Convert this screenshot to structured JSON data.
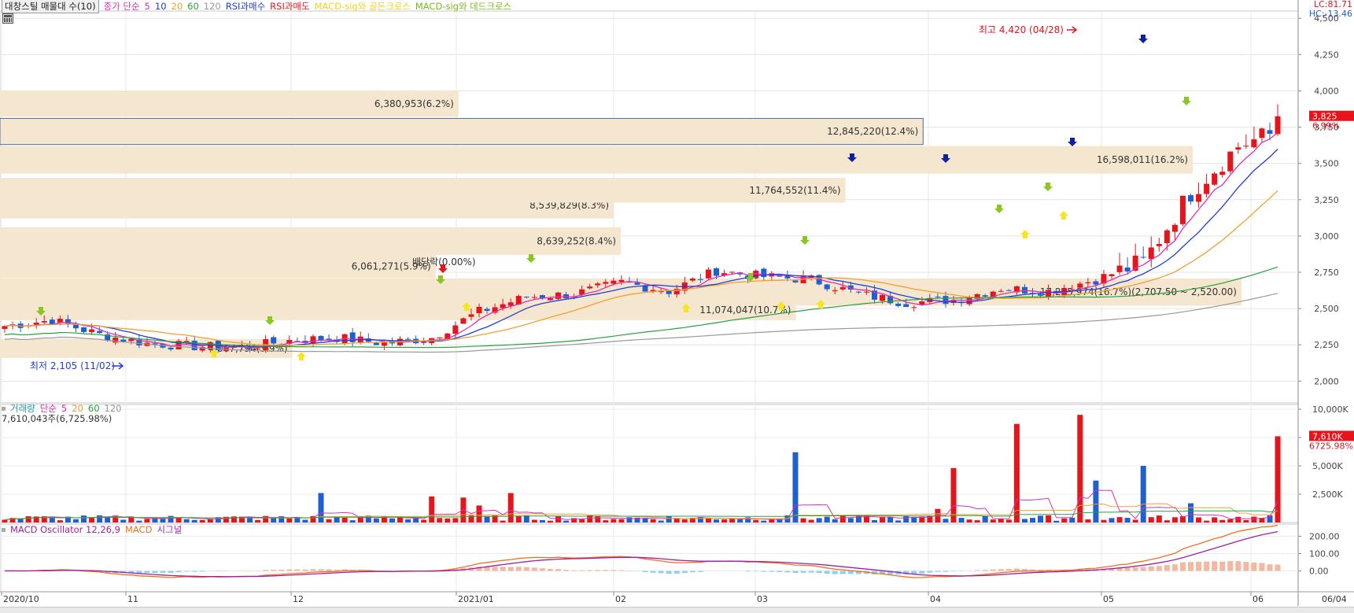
{
  "legend": {
    "main_title": "대창스틸 매물대 수(10)",
    "ma_label": "종가 단순",
    "ma_periods": [
      "5",
      "10",
      "20",
      "60",
      "120"
    ],
    "ma_colors": [
      "#d633b5",
      "#1f3fd6",
      "#f0a030",
      "#2aa040",
      "#999999"
    ],
    "rsi_buy": "RSI과매수",
    "rsi_sell": "RSI과매도",
    "macd_golden": "MACD-sig와 골든크로스",
    "macd_dead": "MACD-sig와 데드크로스"
  },
  "corner": {
    "lc": "LC:81.71",
    "hc": "HC:-13.46"
  },
  "price_label": {
    "value": "3,825",
    "pct": "6.99%"
  },
  "volume_label": {
    "value": "7,610K",
    "pct": "6725.98%"
  },
  "volume_legend": {
    "title": "거래량",
    "ma_label": "단순",
    "periods": [
      "5",
      "20",
      "60",
      "120"
    ],
    "readout": "7,610,043주(6,725.98%)"
  },
  "macd_legend": {
    "osc": "MACD Oscillator 12,26,9",
    "macd": "MACD",
    "signal": "시그널"
  },
  "annotations": {
    "high": "최고 4,420 (04/28)",
    "low": "최저 2,105 (11/02)",
    "dividend": "배당락(0.00%)"
  },
  "colors": {
    "up": "#e8141b",
    "down": "#1f5fd0",
    "zone": "#f5e6d0",
    "zone_border": "#4a6fa5",
    "macd": "#f07020",
    "signal": "#a020a0",
    "osc_pos": "#f4b8a0",
    "osc_neg": "#8fd0f0",
    "arrow_yellow": "#f5e620",
    "arrow_green": "#8ac820",
    "arrow_blue": "#1020a0"
  },
  "chart_data": [
    {
      "type": "candlestick",
      "panel": "price",
      "ylim": [
        1850,
        4550
      ],
      "y_ticks": [
        "2,000",
        "2,250",
        "2,500",
        "2,750",
        "3,000",
        "3,250",
        "3,500",
        "3,750",
        "4,000",
        "4,250",
        "4,500"
      ],
      "x_labels": [
        "2020/10",
        "11",
        "12",
        "2021/01",
        "02",
        "03",
        "04",
        "05",
        "06",
        "06/04"
      ],
      "volume_profile": [
        {
          "label": "4,067,794(3.9%)",
          "lo": 2160,
          "hi": 2290,
          "volume": 4067794
        },
        {
          "label": "11,074,047(10.7%)",
          "lo": 2420,
          "hi": 2560,
          "volume": 11074047
        },
        {
          "label": "17,275,974(16.7%)(2,707.50 ~ 2,520.00)",
          "lo": 2520,
          "hi": 2707.5,
          "volume": 17275974
        },
        {
          "label": "6,061,271(5.9%)",
          "lo": 2710,
          "hi": 2870,
          "volume": 6061271
        },
        {
          "label": "8,639,252(8.4%)",
          "lo": 2870,
          "hi": 3060,
          "volume": 8639252
        },
        {
          "label": "8,539,829(8.3%)",
          "lo": 3120,
          "hi": 3300,
          "volume": 8539829
        },
        {
          "label": "11,764,552(11.4%)",
          "lo": 3230,
          "hi": 3400,
          "volume": 11764552
        },
        {
          "label": "16,598,011(16.2%)",
          "lo": 3430,
          "hi": 3620,
          "volume": 16598011
        },
        {
          "label": "12,845,220(12.4%)",
          "lo": 3630,
          "hi": 3810,
          "volume": 12845220
        },
        {
          "label": "6,380,953(6.2%)",
          "lo": 3820,
          "hi": 4000,
          "volume": 6380953
        }
      ]
    },
    {
      "type": "bar",
      "panel": "volume",
      "ylim": [
        0,
        10000
      ],
      "y_ticks": [
        "2,500K",
        "5,000K",
        "7,500K",
        "10,000K"
      ],
      "unit": "K"
    },
    {
      "type": "line",
      "panel": "macd",
      "ylim": [
        -120,
        270
      ],
      "y_ticks": [
        "0.00",
        "100.00",
        "200.00"
      ],
      "series": [
        {
          "name": "MACD"
        },
        {
          "name": "시그널"
        },
        {
          "name": "MACD Oscillator 12,26,9"
        }
      ]
    }
  ]
}
